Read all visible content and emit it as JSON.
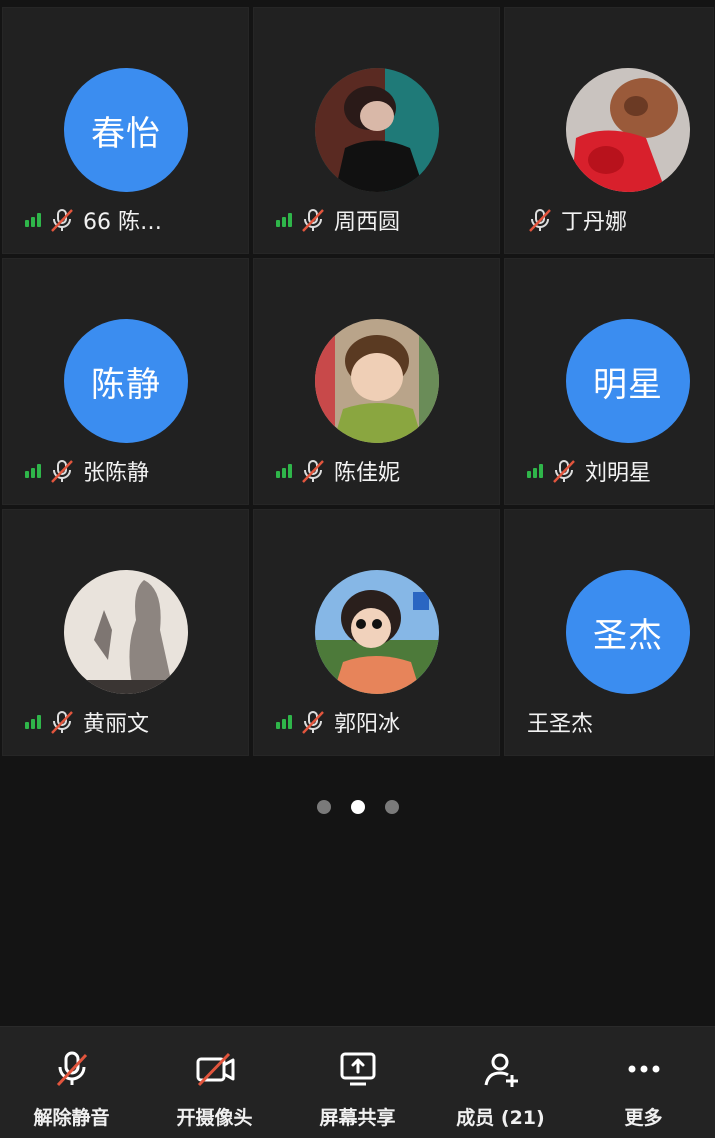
{
  "participants": [
    {
      "avatar_text": "春怡",
      "name": "66 陈…",
      "signal": true
    },
    {
      "avatar_text": "",
      "name": "周西圆",
      "signal": true
    },
    {
      "avatar_text": "",
      "name": "丁丹娜",
      "signal": false
    },
    {
      "avatar_text": "陈静",
      "name": "张陈静",
      "signal": true
    },
    {
      "avatar_text": "",
      "name": "陈佳妮",
      "signal": true
    },
    {
      "avatar_text": "明星",
      "name": "刘明星",
      "signal": true
    },
    {
      "avatar_text": "",
      "name": "黄丽文",
      "signal": true
    },
    {
      "avatar_text": "",
      "name": "郭阳冰",
      "signal": true
    },
    {
      "avatar_text": "圣杰",
      "name": "王圣杰",
      "signal": false
    }
  ],
  "pagination": {
    "pages": 3,
    "current": 2
  },
  "toolbar": {
    "unmute_label": "解除静音",
    "camera_label": "开摄像头",
    "share_label": "屏幕共享",
    "members_label": "成员 (21)",
    "more_label": "更多"
  },
  "colors": {
    "avatar_blue": "#3b8df0",
    "signal_green": "#2fb64a",
    "mute_red": "#e2553d"
  }
}
